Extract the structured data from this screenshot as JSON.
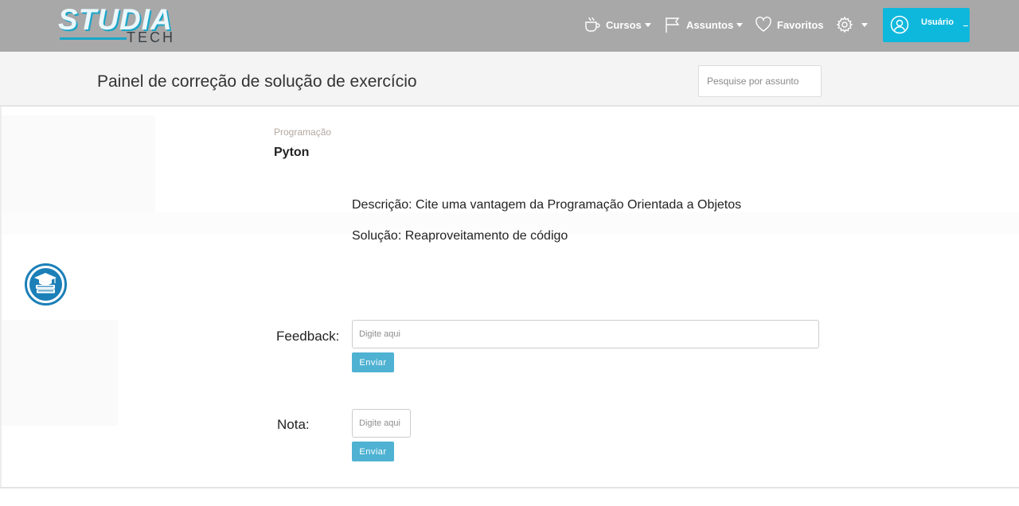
{
  "logo": {
    "main": "STUDIA",
    "sub": "TECH"
  },
  "nav": {
    "courses_label": "Cursos",
    "subjects_label": "Assuntos",
    "favorites_label": "Favoritos",
    "user_label": "Usuário",
    "icons": [
      "coffee-cup-icon",
      "flag-icon",
      "heart-icon",
      "gear-icon",
      "user-circle-icon"
    ]
  },
  "header": {
    "title": "Painel de correção de solução de exercício",
    "search_placeholder": "Pesquise por assunto"
  },
  "exercise": {
    "category": "Programação",
    "topic": "Pyton",
    "description": "Descrição: Cite uma vantagem da Programação Orientada a Objetos",
    "solution": "Solução: Reaproveitamento de código"
  },
  "feedback": {
    "label": "Feedback:",
    "placeholder": "Digite aqui",
    "button": "Enviar"
  },
  "grade": {
    "label": "Nota:",
    "placeholder": "Digite aqui",
    "button": "Enviar"
  },
  "colors": {
    "navbar": "#a8a8a8",
    "accent": "#0eb8dc",
    "button": "#4fb2d2"
  }
}
